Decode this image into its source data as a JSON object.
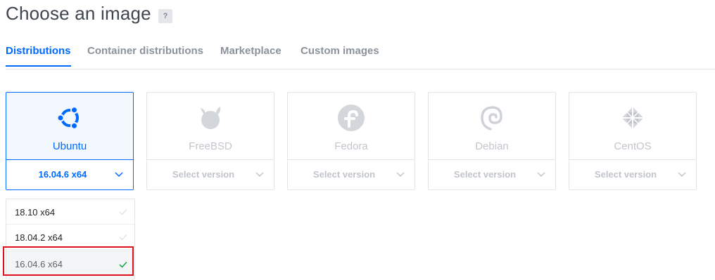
{
  "page": {
    "title": "Choose an image",
    "help_label": "?"
  },
  "tabs": [
    {
      "label": "Distributions",
      "active": true
    },
    {
      "label": "Container distributions",
      "active": false
    },
    {
      "label": "Marketplace",
      "active": false
    },
    {
      "label": "Custom images",
      "active": false
    }
  ],
  "distros": [
    {
      "name": "Ubuntu",
      "version": "16.04.6 x64",
      "selected": true,
      "icon": "ubuntu-logo-icon"
    },
    {
      "name": "FreeBSD",
      "version": "Select version",
      "selected": false,
      "icon": "freebsd-logo-icon"
    },
    {
      "name": "Fedora",
      "version": "Select version",
      "selected": false,
      "icon": "fedora-logo-icon"
    },
    {
      "name": "Debian",
      "version": "Select version",
      "selected": false,
      "icon": "debian-logo-icon"
    },
    {
      "name": "CentOS",
      "version": "Select version",
      "selected": false,
      "icon": "centos-logo-icon"
    }
  ],
  "ubuntu_versions": [
    {
      "label": "18.10 x64",
      "selected": false
    },
    {
      "label": "18.04.2 x64",
      "selected": false
    },
    {
      "label": "16.04.6 x64",
      "selected": true
    }
  ],
  "colors": {
    "accent": "#0069ff",
    "muted": "#c2c6cc",
    "check_selected": "#16a34a",
    "highlight": "#e0111a"
  }
}
